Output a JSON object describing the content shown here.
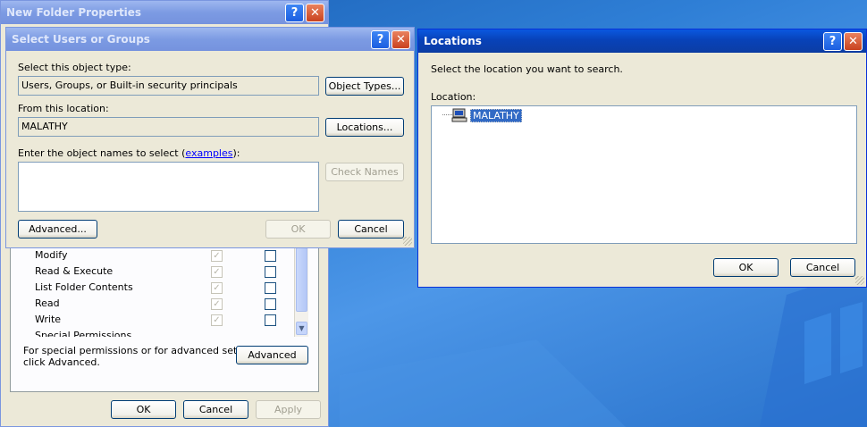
{
  "props_window": {
    "title": "New Folder Properties",
    "permissions": [
      "Modify",
      "Read & Execute",
      "List Folder Contents",
      "Read",
      "Write",
      "Special Permissions"
    ],
    "special_text_line1": "For special permissions or for advanced settings,",
    "special_text_line2": "click Advanced.",
    "advanced_label": "Advanced",
    "ok_label": "OK",
    "cancel_label": "Cancel",
    "apply_label": "Apply"
  },
  "select_dialog": {
    "title": "Select Users or Groups",
    "object_type_label": "Select this object type:",
    "object_type_value": "Users, Groups, or Built-in security principals",
    "object_types_button": "Object Types...",
    "location_label": "From this location:",
    "location_value": "MALATHY",
    "locations_button": "Locations...",
    "enter_names_prefix": "Enter the object names to select (",
    "examples_link": "examples",
    "enter_names_suffix": "):",
    "check_names_button": "Check Names",
    "advanced_button": "Advanced...",
    "ok_button": "OK",
    "cancel_button": "Cancel"
  },
  "locations_dialog": {
    "title": "Locations",
    "instruction": "Select the location you want to search.",
    "location_label": "Location:",
    "tree_item": "MALATHY",
    "ok_button": "OK",
    "cancel_button": "Cancel"
  },
  "titlebar_buttons": {
    "help": "?",
    "close": "✕"
  }
}
